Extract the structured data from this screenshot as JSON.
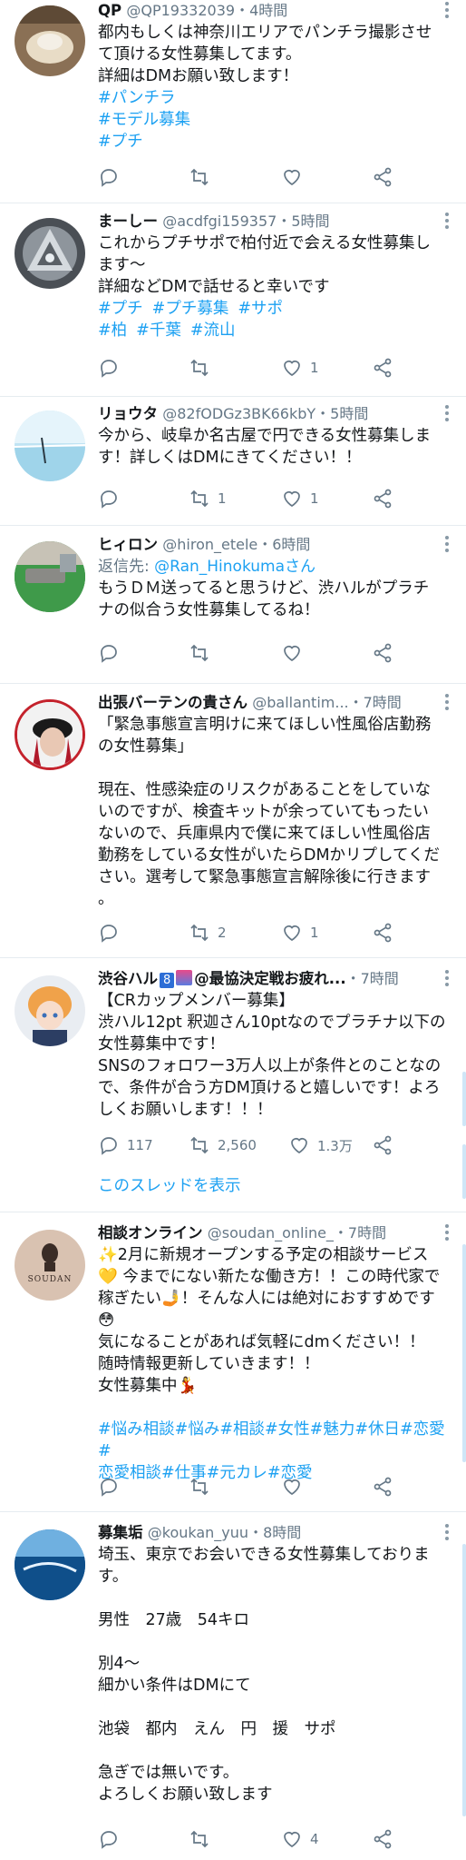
{
  "tweets": [
    {
      "name": "QP",
      "handle": "@QP19332039",
      "time": "・4時間",
      "lines": [
        "都内もしくは神奈川エリアでパンチラ撮影させ",
        "て頂ける女性募集してます。",
        "詳細はDMお願い致します！"
      ],
      "tags": [
        "#パンチラ",
        "#モデル募集",
        "#プチ"
      ],
      "counts": {
        "reply": "",
        "retweet": "",
        "like": ""
      }
    },
    {
      "name": "まーしー",
      "handle": "@acdfgi159357",
      "time": "・5時間",
      "lines": [
        "これからプチサポで柏付近で会える女性募集し",
        "ます〜",
        "詳細などDMで話せると幸いです"
      ],
      "tags_row1": [
        "#プチ",
        "#プチ募集",
        "#サポ"
      ],
      "tags_row2": [
        "#柏",
        "#千葉",
        "#流山"
      ],
      "counts": {
        "reply": "",
        "retweet": "",
        "like": "1"
      }
    },
    {
      "name": "リョウタ",
      "handle": "@82fODGz3BK66kbY",
      "time": "・5時間",
      "lines": [
        "今から、岐阜か名古屋で円できる女性募集しま",
        "す！詳しくはDMにきてください！！"
      ],
      "counts": {
        "reply": "",
        "retweet": "1",
        "like": "1"
      }
    },
    {
      "name": "ヒィロン",
      "handle": "@hiron_etele",
      "time": "・6時間",
      "reply_label": "返信先: ",
      "reply_target": "@Ran_Hinokumaさん",
      "lines": [
        "もうＤＭ送ってると思うけど、渋ハルがプラチ",
        "ナの似合う女性募集してるね！"
      ],
      "counts": {
        "reply": "",
        "retweet": "",
        "like": ""
      }
    },
    {
      "name": "出張バーテンの貴さん",
      "handle": "@ballantim...",
      "time": "・7時間",
      "lines": [
        "「緊急事態宣言明けに来てほしい性風俗店勤務",
        "の女性募集」",
        "",
        "現在、性感染症のリスクがあることをしていな",
        "いのですが、検査キットが余っていてもったい",
        "ないので、兵庫県内で僕に来てほしい性風俗店",
        "勤務をしている女性がいたらDMかリプしてくだ",
        "さい。選考して緊急事態宣言解除後に行きます",
        "。"
      ],
      "counts": {
        "reply": "",
        "retweet": "2",
        "like": "1"
      }
    },
    {
      "name": "渋谷ハル",
      "name_badge": "8",
      "name_suffix": "@最協決定戦お疲れ...",
      "time": "・7時間",
      "lines": [
        "【CRカップメンバー募集】",
        "渋ハル12pt 釈迦さん10ptなのでプラチナ以下の",
        "女性募集中です！",
        "SNSのフォロワー3万人以上が条件とのことなの",
        "で、条件が合う方DM頂けると嬉しいです！よろ",
        "しくお願いします！！！"
      ],
      "counts": {
        "reply": "117",
        "retweet": "2,560",
        "like": "1.3万"
      },
      "thread_link": "このスレッドを表示"
    },
    {
      "name": "相談オンライン",
      "handle": "@soudan_online_",
      "time": "・7時間",
      "avatar_text": "SOUDAN",
      "lines": [
        "✨2月に新規オープンする予定の相談サービス",
        "💛 今までにない新たな働き方！！この時代家で",
        "稼ぎたい🤳！そんな人には絶対におすすめです",
        "😳",
        "気になることがあれば気軽にdmください！！",
        "随時情報更新していきます！！",
        "女性募集中💃",
        "",
        "#悩み相談#悩み#相談#女性#魅力#休日#恋愛#",
        "恋愛相談#仕事#元カレ#恋愛"
      ],
      "counts": {
        "reply": "",
        "retweet": "",
        "like": ""
      }
    },
    {
      "name": "募集垢",
      "handle": "@koukan_yuu",
      "time": "・8時間",
      "lines": [
        "埼玉、東京でお会いできる女性募集しておりま",
        "す。",
        "",
        "男性　27歳　54キロ",
        "",
        "別4〜",
        "細かい条件はDMにて",
        "",
        "池袋　都内　えん　円　援　サポ",
        "",
        "急ぎでは無いです。",
        "よろしくお願い致します"
      ],
      "counts": {
        "reply": "",
        "retweet": "",
        "like": "4"
      }
    }
  ],
  "colors": {
    "link": "#1da1f2",
    "secondary": "#657786",
    "divider": "#e6ecf0"
  },
  "icons": [
    "reply-icon",
    "retweet-icon",
    "like-icon",
    "share-icon",
    "more-icon"
  ]
}
